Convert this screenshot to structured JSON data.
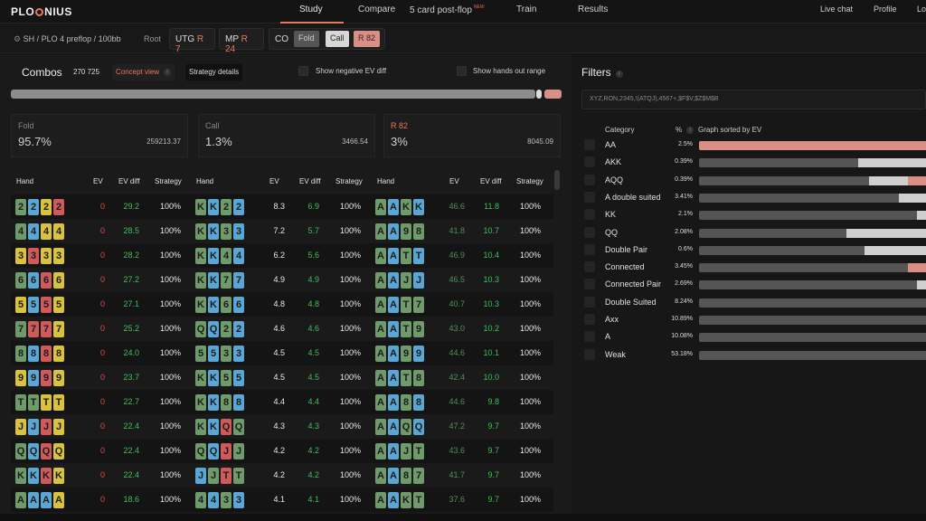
{
  "nav": {
    "logo_left": "PLO",
    "logo_right": "NIUS",
    "study": "Study",
    "compare": "Compare",
    "five_card": "5 card post-flop",
    "new_badge": "NEW",
    "train": "Train",
    "results": "Results",
    "live_chat": "Live chat",
    "profile": "Profile",
    "logout": "Lo"
  },
  "subbar": {
    "game": "SH / PLO 4 preflop / 100bb",
    "root": "Root",
    "utg_pos": "UTG",
    "utg_action": "R 7",
    "mp_pos": "MP",
    "mp_action": "R 24",
    "co_pos": "CO",
    "fold": "Fold",
    "call": "Call",
    "raise": "R 82"
  },
  "left": {
    "combos_title": "Combos",
    "combos_count": "270 725",
    "concept_view": "Concept view",
    "strategy_details": "Strategy details",
    "show_negative": "Show negative EV diff",
    "show_hands_out": "Show hands out range",
    "stats": [
      {
        "label": "Fold",
        "value": "95.7%",
        "count": "259213.37"
      },
      {
        "label": "Call",
        "value": "1.3%",
        "count": "3466.54"
      },
      {
        "label": "R 82",
        "value": "3%",
        "count": "8045.09"
      }
    ],
    "headers": {
      "hand": "Hand",
      "ev": "EV",
      "ev_diff": "EV diff",
      "strategy": "Strategy"
    },
    "columns": [
      [
        {
          "cards": [
            "2",
            "2",
            "2",
            "2"
          ],
          "suits": [
            "g",
            "b",
            "y",
            "r"
          ],
          "ev": "0",
          "diff": "29.2",
          "strat": "100%"
        },
        {
          "cards": [
            "4",
            "4",
            "4",
            "4"
          ],
          "suits": [
            "g",
            "b",
            "y",
            "y"
          ],
          "ev": "0",
          "diff": "28.5",
          "strat": "100%"
        },
        {
          "cards": [
            "3",
            "3",
            "3",
            "3"
          ],
          "suits": [
            "y",
            "r",
            "y",
            "y"
          ],
          "ev": "0",
          "diff": "28.2",
          "strat": "100%"
        },
        {
          "cards": [
            "6",
            "6",
            "6",
            "6"
          ],
          "suits": [
            "g",
            "b",
            "r",
            "y"
          ],
          "ev": "0",
          "diff": "27.2",
          "strat": "100%"
        },
        {
          "cards": [
            "5",
            "5",
            "5",
            "5"
          ],
          "suits": [
            "y",
            "b",
            "r",
            "y"
          ],
          "ev": "0",
          "diff": "27.1",
          "strat": "100%"
        },
        {
          "cards": [
            "7",
            "7",
            "7",
            "7"
          ],
          "suits": [
            "g",
            "r",
            "r",
            "y"
          ],
          "ev": "0",
          "diff": "25.2",
          "strat": "100%"
        },
        {
          "cards": [
            "8",
            "8",
            "8",
            "8"
          ],
          "suits": [
            "g",
            "b",
            "r",
            "y"
          ],
          "ev": "0",
          "diff": "24.0",
          "strat": "100%"
        },
        {
          "cards": [
            "9",
            "9",
            "9",
            "9"
          ],
          "suits": [
            "y",
            "b",
            "r",
            "y"
          ],
          "ev": "0",
          "diff": "23.7",
          "strat": "100%"
        },
        {
          "cards": [
            "T",
            "T",
            "T",
            "T"
          ],
          "suits": [
            "g",
            "g",
            "y",
            "y"
          ],
          "ev": "0",
          "diff": "22.7",
          "strat": "100%"
        },
        {
          "cards": [
            "J",
            "J",
            "J",
            "J"
          ],
          "suits": [
            "y",
            "b",
            "r",
            "y"
          ],
          "ev": "0",
          "diff": "22.4",
          "strat": "100%"
        },
        {
          "cards": [
            "Q",
            "Q",
            "Q",
            "Q"
          ],
          "suits": [
            "g",
            "b",
            "r",
            "y"
          ],
          "ev": "0",
          "diff": "22.4",
          "strat": "100%"
        },
        {
          "cards": [
            "K",
            "K",
            "K",
            "K"
          ],
          "suits": [
            "g",
            "b",
            "r",
            "y"
          ],
          "ev": "0",
          "diff": "22.4",
          "strat": "100%"
        },
        {
          "cards": [
            "A",
            "A",
            "A",
            "A"
          ],
          "suits": [
            "g",
            "b",
            "b",
            "y"
          ],
          "ev": "0",
          "diff": "18.6",
          "strat": "100%"
        }
      ],
      [
        {
          "cards": [
            "K",
            "K",
            "2",
            "2"
          ],
          "suits": [
            "g",
            "b",
            "g",
            "b"
          ],
          "ev": "8.3",
          "diff": "6.9",
          "strat": "100%"
        },
        {
          "cards": [
            "K",
            "K",
            "3",
            "3"
          ],
          "suits": [
            "g",
            "b",
            "g",
            "b"
          ],
          "ev": "7.2",
          "diff": "5.7",
          "strat": "100%"
        },
        {
          "cards": [
            "K",
            "K",
            "4",
            "4"
          ],
          "suits": [
            "g",
            "b",
            "g",
            "b"
          ],
          "ev": "6.2",
          "diff": "5.6",
          "strat": "100%"
        },
        {
          "cards": [
            "K",
            "K",
            "7",
            "7"
          ],
          "suits": [
            "g",
            "b",
            "g",
            "b"
          ],
          "ev": "4.9",
          "diff": "4.9",
          "strat": "100%"
        },
        {
          "cards": [
            "K",
            "K",
            "6",
            "6"
          ],
          "suits": [
            "g",
            "b",
            "g",
            "b"
          ],
          "ev": "4.8",
          "diff": "4.8",
          "strat": "100%"
        },
        {
          "cards": [
            "Q",
            "Q",
            "2",
            "2"
          ],
          "suits": [
            "g",
            "b",
            "g",
            "b"
          ],
          "ev": "4.6",
          "diff": "4.6",
          "strat": "100%"
        },
        {
          "cards": [
            "5",
            "5",
            "3",
            "3"
          ],
          "suits": [
            "g",
            "b",
            "g",
            "b"
          ],
          "ev": "4.5",
          "diff": "4.5",
          "strat": "100%"
        },
        {
          "cards": [
            "K",
            "K",
            "5",
            "5"
          ],
          "suits": [
            "g",
            "b",
            "g",
            "b"
          ],
          "ev": "4.5",
          "diff": "4.5",
          "strat": "100%"
        },
        {
          "cards": [
            "K",
            "K",
            "8",
            "8"
          ],
          "suits": [
            "g",
            "b",
            "g",
            "b"
          ],
          "ev": "4.4",
          "diff": "4.4",
          "strat": "100%"
        },
        {
          "cards": [
            "K",
            "K",
            "Q",
            "Q"
          ],
          "suits": [
            "g",
            "b",
            "r",
            "g"
          ],
          "ev": "4.3",
          "diff": "4.3",
          "strat": "100%"
        },
        {
          "cards": [
            "Q",
            "Q",
            "J",
            "J"
          ],
          "suits": [
            "g",
            "b",
            "r",
            "g"
          ],
          "ev": "4.2",
          "diff": "4.2",
          "strat": "100%"
        },
        {
          "cards": [
            "J",
            "J",
            "T",
            "T"
          ],
          "suits": [
            "b",
            "g",
            "r",
            "g"
          ],
          "ev": "4.2",
          "diff": "4.2",
          "strat": "100%"
        },
        {
          "cards": [
            "4",
            "4",
            "3",
            "3"
          ],
          "suits": [
            "g",
            "b",
            "g",
            "b"
          ],
          "ev": "4.1",
          "diff": "4.1",
          "strat": "100%"
        }
      ],
      [
        {
          "cards": [
            "A",
            "A",
            "K",
            "K"
          ],
          "suits": [
            "g",
            "b",
            "g",
            "b"
          ],
          "ev": "46.6",
          "diff": "11.8",
          "strat": "100%"
        },
        {
          "cards": [
            "A",
            "A",
            "9",
            "8"
          ],
          "suits": [
            "g",
            "b",
            "g",
            "g"
          ],
          "ev": "41.8",
          "diff": "10.7",
          "strat": "100%"
        },
        {
          "cards": [
            "A",
            "A",
            "T",
            "T"
          ],
          "suits": [
            "g",
            "b",
            "g",
            "b"
          ],
          "ev": "46.9",
          "diff": "10.4",
          "strat": "100%"
        },
        {
          "cards": [
            "A",
            "A",
            "J",
            "J"
          ],
          "suits": [
            "g",
            "b",
            "g",
            "b"
          ],
          "ev": "46.5",
          "diff": "10.3",
          "strat": "100%"
        },
        {
          "cards": [
            "A",
            "A",
            "T",
            "7"
          ],
          "suits": [
            "g",
            "b",
            "g",
            "g"
          ],
          "ev": "40.7",
          "diff": "10.3",
          "strat": "100%"
        },
        {
          "cards": [
            "A",
            "A",
            "T",
            "9"
          ],
          "suits": [
            "g",
            "b",
            "g",
            "g"
          ],
          "ev": "43.0",
          "diff": "10.2",
          "strat": "100%"
        },
        {
          "cards": [
            "A",
            "A",
            "9",
            "9"
          ],
          "suits": [
            "g",
            "b",
            "g",
            "b"
          ],
          "ev": "44.6",
          "diff": "10.1",
          "strat": "100%"
        },
        {
          "cards": [
            "A",
            "A",
            "T",
            "8"
          ],
          "suits": [
            "g",
            "b",
            "g",
            "g"
          ],
          "ev": "42.4",
          "diff": "10.0",
          "strat": "100%"
        },
        {
          "cards": [
            "A",
            "A",
            "8",
            "8"
          ],
          "suits": [
            "g",
            "b",
            "g",
            "b"
          ],
          "ev": "44.6",
          "diff": "9.8",
          "strat": "100%"
        },
        {
          "cards": [
            "A",
            "A",
            "Q",
            "Q"
          ],
          "suits": [
            "g",
            "b",
            "g",
            "b"
          ],
          "ev": "47.2",
          "diff": "9.7",
          "strat": "100%"
        },
        {
          "cards": [
            "A",
            "A",
            "J",
            "T"
          ],
          "suits": [
            "g",
            "b",
            "g",
            "g"
          ],
          "ev": "43.6",
          "diff": "9.7",
          "strat": "100%"
        },
        {
          "cards": [
            "A",
            "A",
            "8",
            "7"
          ],
          "suits": [
            "g",
            "b",
            "g",
            "g"
          ],
          "ev": "41.7",
          "diff": "9.7",
          "strat": "100%"
        },
        {
          "cards": [
            "A",
            "A",
            "K",
            "T"
          ],
          "suits": [
            "g",
            "b",
            "g",
            "g"
          ],
          "ev": "37.6",
          "diff": "9.7",
          "strat": "100%"
        }
      ]
    ]
  },
  "filters": {
    "title": "Filters",
    "query": "XYZ,RON,2345,!(ATQJ),4567+,$F$V,$Z$M$B",
    "hdr_category": "Category",
    "hdr_pct": "%",
    "hdr_graph": "Graph sorted by EV",
    "rows": [
      {
        "name": "AA",
        "pct": "2.5%",
        "red": 1.0,
        "light": 0.0
      },
      {
        "name": "AKK",
        "pct": "0.39%",
        "red": 0.0,
        "light": 0.3
      },
      {
        "name": "AQQ",
        "pct": "0.39%",
        "red": 0.08,
        "light": 0.17
      },
      {
        "name": "A double suited",
        "pct": "3.41%",
        "red": 0.0,
        "light": 0.12
      },
      {
        "name": "KK",
        "pct": "2.1%",
        "red": 0.0,
        "light": 0.04
      },
      {
        "name": "QQ",
        "pct": "2.08%",
        "red": 0.0,
        "light": 0.35
      },
      {
        "name": "Double Pair",
        "pct": "0.6%",
        "red": 0.0,
        "light": 0.27
      },
      {
        "name": "Connected",
        "pct": "3.45%",
        "red": 0.08,
        "light": 0.0
      },
      {
        "name": "Connected Pair",
        "pct": "2.69%",
        "red": 0.0,
        "light": 0.04
      },
      {
        "name": "Double Suited",
        "pct": "8.24%",
        "red": 0.0,
        "light": 0.0
      },
      {
        "name": "Axx",
        "pct": "10.89%",
        "red": 0.0,
        "light": 0.0
      },
      {
        "name": "A",
        "pct": "10.08%",
        "red": 0.0,
        "light": 0.0
      },
      {
        "name": "Weak",
        "pct": "53.18%",
        "red": 0.0,
        "light": 0.0
      }
    ]
  },
  "colors": {
    "accent": "#e8795c",
    "card_g": "#6f9a6a",
    "card_b": "#5aa7d6",
    "card_y": "#d9c23c",
    "card_r": "#d0595a",
    "ev_zero": "#e14a43",
    "ev_green": "#3fbf5c"
  }
}
